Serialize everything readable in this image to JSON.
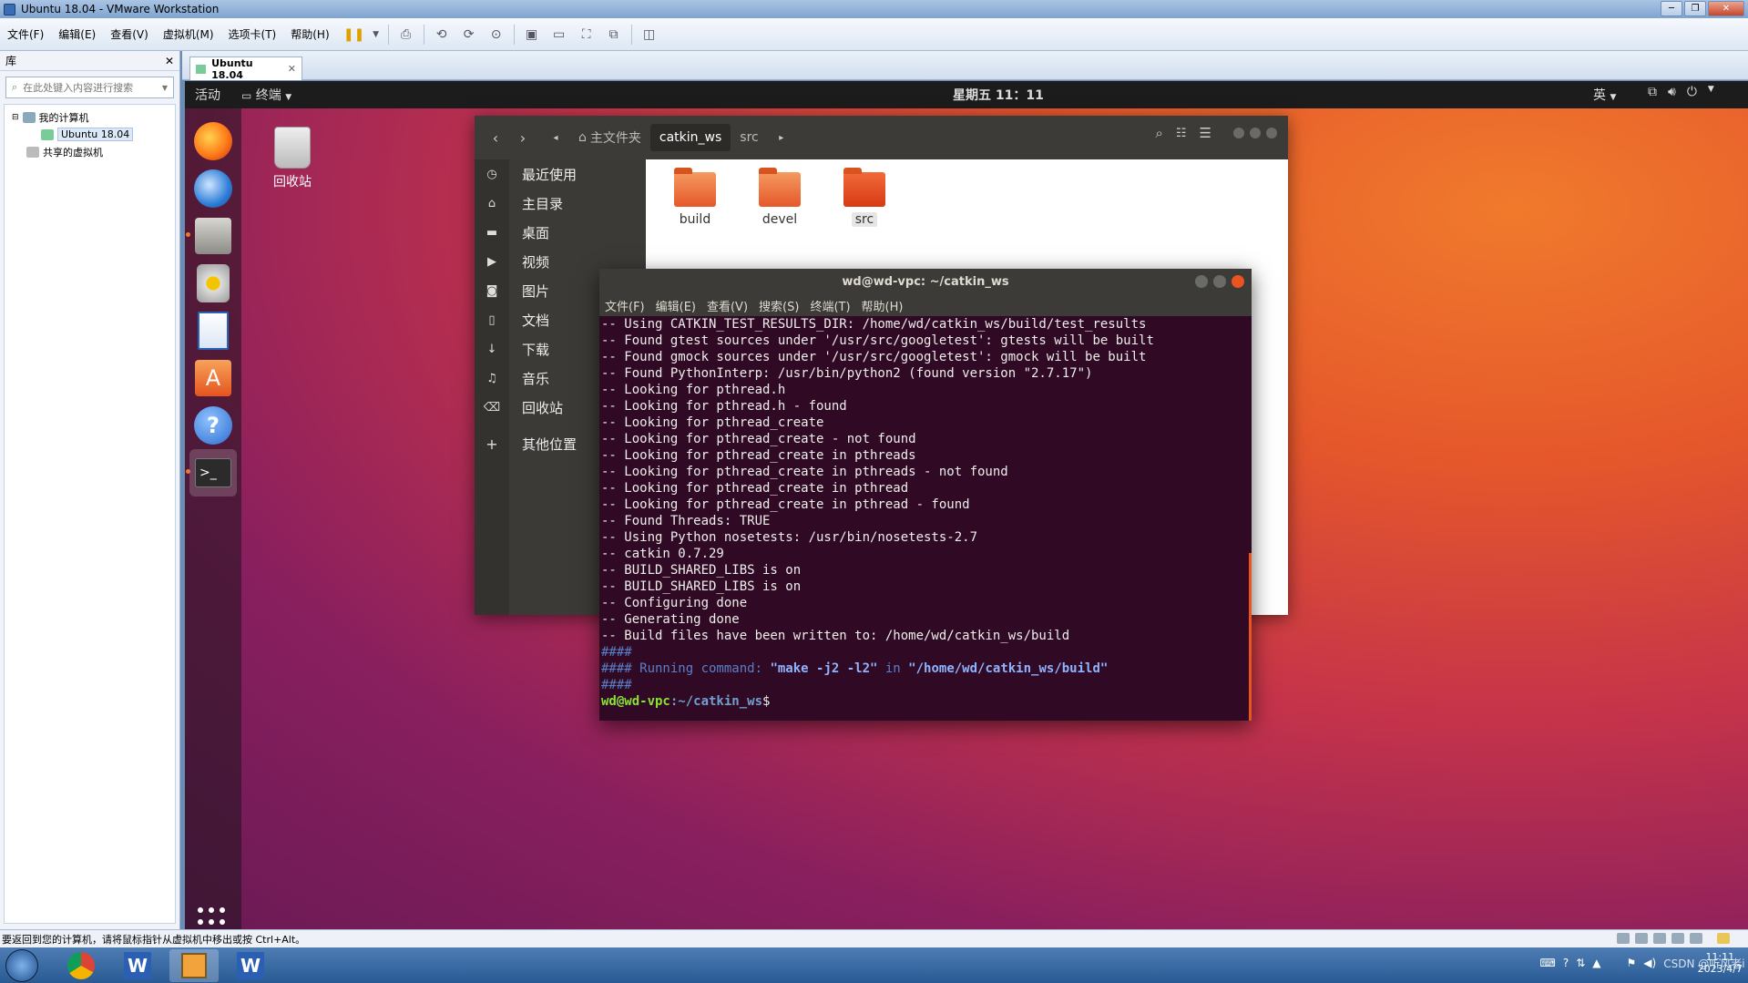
{
  "vmware": {
    "title": "Ubuntu 18.04 - VMware Workstation",
    "menu": [
      "文件(F)",
      "编辑(E)",
      "查看(V)",
      "虚拟机(M)",
      "选项卡(T)",
      "帮助(H)"
    ],
    "library": {
      "heading": "库",
      "search_placeholder": "在此处键入内容进行搜索",
      "tree": {
        "my_computer": "我的计算机",
        "vm": "Ubuntu 18.04",
        "shared": "共享的虚拟机"
      }
    },
    "tab_label": "Ubuntu 18.04",
    "status_text": "要返回到您的计算机，请将鼠标指针从虚拟机中移出或按 Ctrl+Alt。"
  },
  "ubuntu": {
    "topbar": {
      "activities": "活动",
      "app_menu": "终端",
      "clock": "星期五 11：11",
      "ime": "英"
    },
    "desktop_trash": "回收站"
  },
  "nautilus": {
    "breadcrumbs": [
      "主文件夹",
      "catkin_ws",
      "src"
    ],
    "sidebar": [
      "最近使用",
      "主目录",
      "桌面",
      "视频",
      "图片",
      "文档",
      "下载",
      "音乐",
      "回收站",
      "其他位置"
    ],
    "folders": [
      "build",
      "devel",
      "src"
    ]
  },
  "terminal": {
    "title": "wd@wd-vpc: ~/catkin_ws",
    "menu": [
      "文件(F)",
      "编辑(E)",
      "查看(V)",
      "搜索(S)",
      "终端(T)",
      "帮助(H)"
    ],
    "output": [
      "-- Using CATKIN_TEST_RESULTS_DIR: /home/wd/catkin_ws/build/test_results",
      "-- Found gtest sources under '/usr/src/googletest': gtests will be built",
      "-- Found gmock sources under '/usr/src/googletest': gmock will be built",
      "-- Found PythonInterp: /usr/bin/python2 (found version \"2.7.17\")",
      "-- Looking for pthread.h",
      "-- Looking for pthread.h - found",
      "-- Looking for pthread_create",
      "-- Looking for pthread_create - not found",
      "-- Looking for pthread_create in pthreads",
      "-- Looking for pthread_create in pthreads - not found",
      "-- Looking for pthread_create in pthread",
      "-- Looking for pthread_create in pthread - found",
      "-- Found Threads: TRUE",
      "-- Using Python nosetests: /usr/bin/nosetests-2.7",
      "-- catkin 0.7.29",
      "-- BUILD_SHARED_LIBS is on",
      "-- BUILD_SHARED_LIBS is on",
      "-- Configuring done",
      "-- Generating done",
      "-- Build files have been written to: /home/wd/catkin_ws/build"
    ],
    "hash_line": "####",
    "running_prefix": "#### Running command: ",
    "running_cmd": "\"make -j2 -l2\"",
    "running_in": " in ",
    "running_dir": "\"/home/wd/catkin_ws/build\"",
    "prompt_user": "wd@wd-vpc",
    "prompt_path": ":~/catkin_ws",
    "prompt_end": "$"
  },
  "taskbar": {
    "clock_time": "11:11",
    "clock_date": "2023/4/7",
    "watermark": "CSDN @听风者i"
  }
}
